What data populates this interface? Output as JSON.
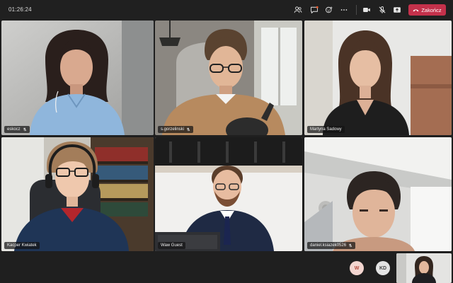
{
  "meeting": {
    "timer": "01:26:24",
    "leave_label": "Zakończ"
  },
  "toolbar": {
    "icons": [
      "people-icon",
      "chat-icon",
      "reactions-icon",
      "more-icon",
      "camera-icon",
      "mic-off-icon",
      "share-icon",
      "phone-icon"
    ]
  },
  "participants": [
    {
      "name": "eskocz",
      "muted": true
    },
    {
      "name": "s.gorzelinski",
      "muted": true
    },
    {
      "name": "Martyna Sadowy",
      "muted": false
    },
    {
      "name": "Kacper Kwiatek",
      "muted": false
    },
    {
      "name": "Waw Guest",
      "muted": false
    },
    {
      "name": "daniel.ksiazek0526",
      "muted": true
    }
  ],
  "bottom_avatars": [
    {
      "initials": "W",
      "bg": "#f3d6d0",
      "fg": "#b5483a"
    },
    {
      "initials": "KD",
      "bg": "#e4e4e4",
      "fg": "#444444"
    }
  ],
  "colors": {
    "background": "#1f1f1f",
    "leave": "#c4314b",
    "nametag": "#141414"
  }
}
